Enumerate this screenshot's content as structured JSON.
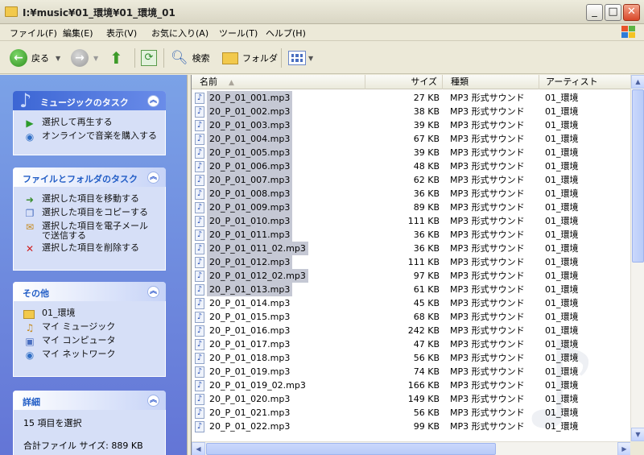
{
  "window": {
    "title": "I:¥music¥01_環境¥01_環境_01"
  },
  "menu": [
    "ファイル(F)",
    "編集(E)",
    "表示(V)",
    "お気に入り(A)",
    "ツール(T)",
    "ヘルプ(H)"
  ],
  "toolbar": {
    "back": "戻る",
    "search": "検索",
    "folders": "フォルダ"
  },
  "tasks": {
    "music": {
      "title": "ミュージックのタスク",
      "items": [
        "選択して再生する",
        "オンラインで音楽を購入する"
      ]
    },
    "filefolder": {
      "title": "ファイルとフォルダのタスク",
      "items": [
        "選択した項目を移動する",
        "選択した項目をコピーする",
        "選択した項目を電子メール",
        "で送信する",
        "選択した項目を削除する"
      ]
    },
    "other": {
      "title": "その他",
      "items": [
        "01_環境",
        "マイ ミュージック",
        "マイ コンピュータ",
        "マイ ネットワーク"
      ]
    },
    "details": {
      "title": "詳細",
      "selected": "15 項目を選択",
      "total": "合計ファイル サイズ: 889 KB"
    }
  },
  "columns": {
    "name": "名前",
    "size": "サイズ",
    "type": "種類",
    "artist": "アーティスト"
  },
  "files": [
    {
      "name": "20_P_01_001.mp3",
      "size": "27 KB",
      "type": "MP3 形式サウンド",
      "artist": "01_環境",
      "selected": true
    },
    {
      "name": "20_P_01_002.mp3",
      "size": "38 KB",
      "type": "MP3 形式サウンド",
      "artist": "01_環境",
      "selected": true
    },
    {
      "name": "20_P_01_003.mp3",
      "size": "39 KB",
      "type": "MP3 形式サウンド",
      "artist": "01_環境",
      "selected": true
    },
    {
      "name": "20_P_01_004.mp3",
      "size": "67 KB",
      "type": "MP3 形式サウンド",
      "artist": "01_環境",
      "selected": true
    },
    {
      "name": "20_P_01_005.mp3",
      "size": "39 KB",
      "type": "MP3 形式サウンド",
      "artist": "01_環境",
      "selected": true
    },
    {
      "name": "20_P_01_006.mp3",
      "size": "48 KB",
      "type": "MP3 形式サウンド",
      "artist": "01_環境",
      "selected": true
    },
    {
      "name": "20_P_01_007.mp3",
      "size": "62 KB",
      "type": "MP3 形式サウンド",
      "artist": "01_環境",
      "selected": true
    },
    {
      "name": "20_P_01_008.mp3",
      "size": "36 KB",
      "type": "MP3 形式サウンド",
      "artist": "01_環境",
      "selected": true
    },
    {
      "name": "20_P_01_009.mp3",
      "size": "89 KB",
      "type": "MP3 形式サウンド",
      "artist": "01_環境",
      "selected": true
    },
    {
      "name": "20_P_01_010.mp3",
      "size": "111 KB",
      "type": "MP3 形式サウンド",
      "artist": "01_環境",
      "selected": true
    },
    {
      "name": "20_P_01_011.mp3",
      "size": "36 KB",
      "type": "MP3 形式サウンド",
      "artist": "01_環境",
      "selected": true
    },
    {
      "name": "20_P_01_011_02.mp3",
      "size": "36 KB",
      "type": "MP3 形式サウンド",
      "artist": "01_環境",
      "selected": true
    },
    {
      "name": "20_P_01_012.mp3",
      "size": "111 KB",
      "type": "MP3 形式サウンド",
      "artist": "01_環境",
      "selected": true
    },
    {
      "name": "20_P_01_012_02.mp3",
      "size": "97 KB",
      "type": "MP3 形式サウンド",
      "artist": "01_環境",
      "selected": true
    },
    {
      "name": "20_P_01_013.mp3",
      "size": "61 KB",
      "type": "MP3 形式サウンド",
      "artist": "01_環境",
      "selected": true
    },
    {
      "name": "20_P_01_014.mp3",
      "size": "45 KB",
      "type": "MP3 形式サウンド",
      "artist": "01_環境",
      "selected": false
    },
    {
      "name": "20_P_01_015.mp3",
      "size": "68 KB",
      "type": "MP3 形式サウンド",
      "artist": "01_環境",
      "selected": false
    },
    {
      "name": "20_P_01_016.mp3",
      "size": "242 KB",
      "type": "MP3 形式サウンド",
      "artist": "01_環境",
      "selected": false
    },
    {
      "name": "20_P_01_017.mp3",
      "size": "47 KB",
      "type": "MP3 形式サウンド",
      "artist": "01_環境",
      "selected": false
    },
    {
      "name": "20_P_01_018.mp3",
      "size": "56 KB",
      "type": "MP3 形式サウンド",
      "artist": "01_環境",
      "selected": false
    },
    {
      "name": "20_P_01_019.mp3",
      "size": "74 KB",
      "type": "MP3 形式サウンド",
      "artist": "01_環境",
      "selected": false
    },
    {
      "name": "20_P_01_019_02.mp3",
      "size": "166 KB",
      "type": "MP3 形式サウンド",
      "artist": "01_環境",
      "selected": false
    },
    {
      "name": "20_P_01_020.mp3",
      "size": "149 KB",
      "type": "MP3 形式サウンド",
      "artist": "01_環境",
      "selected": false
    },
    {
      "name": "20_P_01_021.mp3",
      "size": "56 KB",
      "type": "MP3 形式サウンド",
      "artist": "01_環境",
      "selected": false
    },
    {
      "name": "20_P_01_022.mp3",
      "size": "99 KB",
      "type": "MP3 形式サウンド",
      "artist": "01_環境",
      "selected": false
    }
  ],
  "icons": {
    "file": "music-note-icon",
    "folder": "folder-icon"
  }
}
